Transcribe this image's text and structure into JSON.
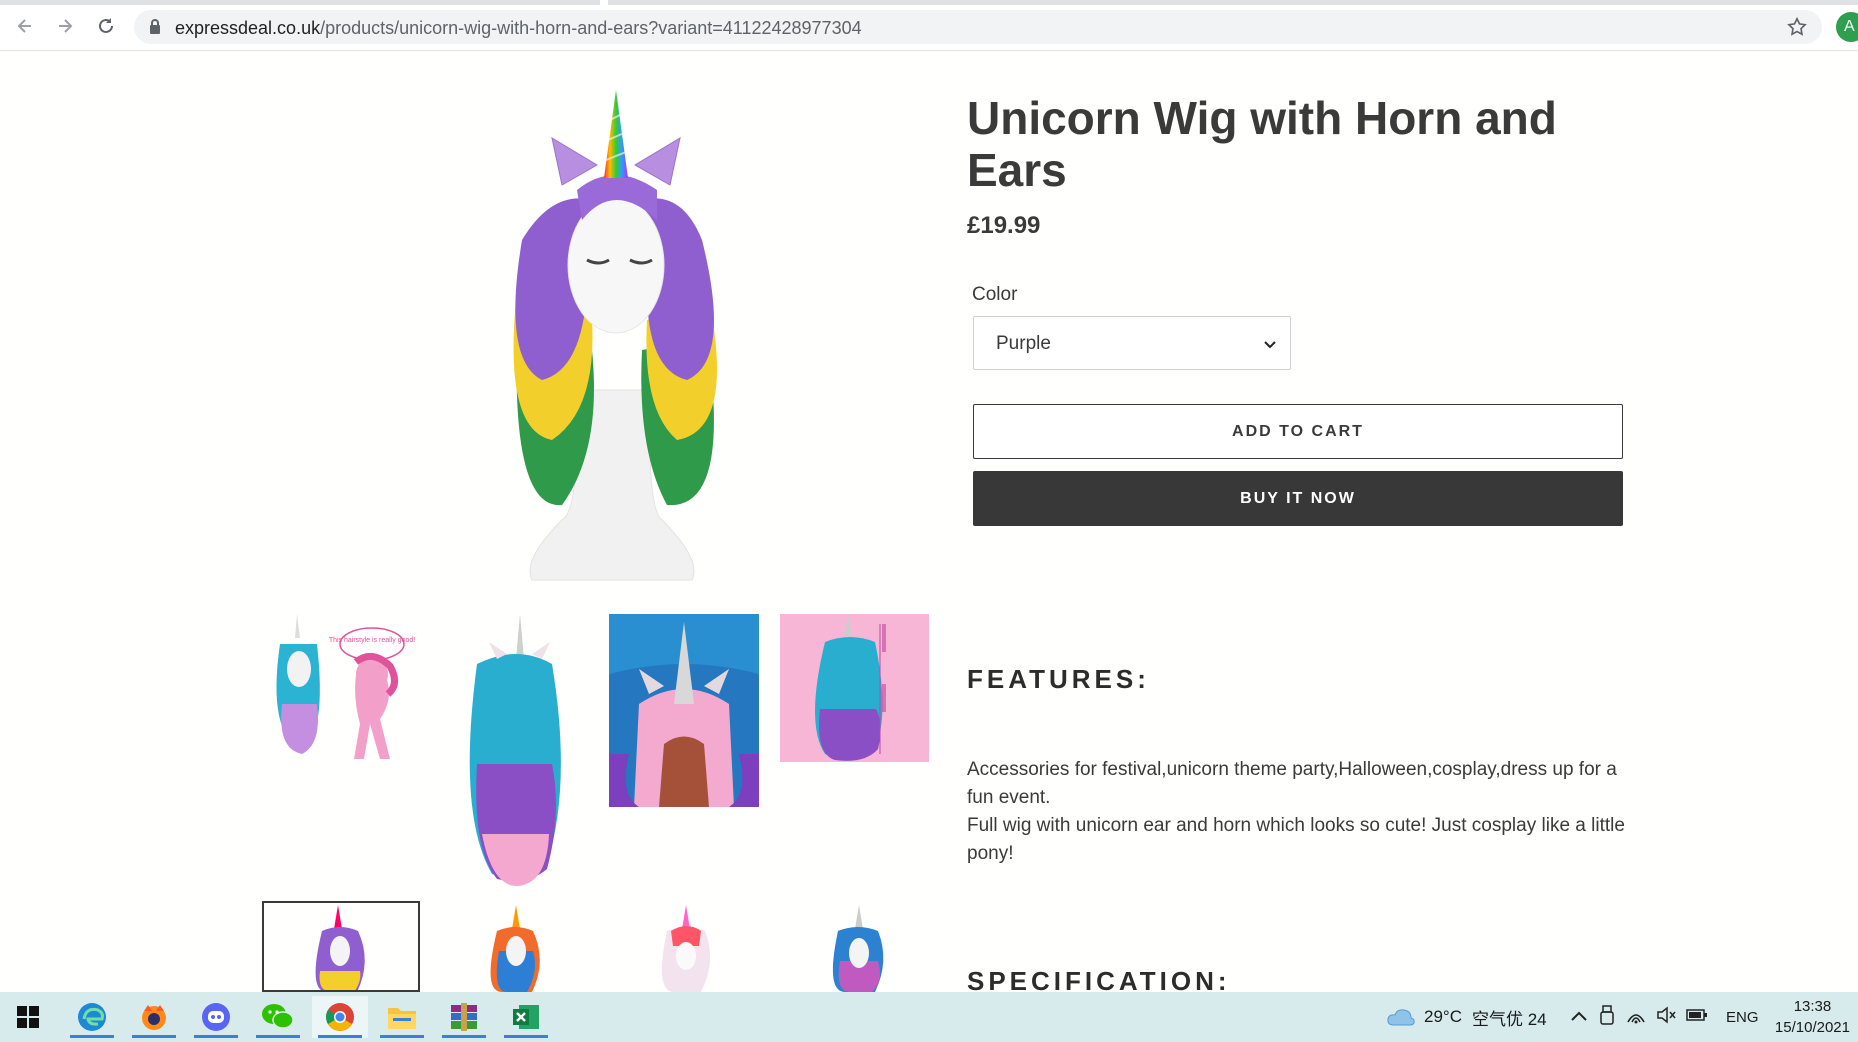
{
  "browser": {
    "url_host": "expressdeal.co.uk",
    "url_path": "/products/unicorn-wig-with-horn-and-ears?variant=41122428977304",
    "profile_initial": "A"
  },
  "product": {
    "title": "Unicorn Wig with Horn and Ears",
    "price": "£19.99",
    "option_label": "Color",
    "option_selected": "Purple",
    "add_to_cart": "ADD TO CART",
    "buy_now": "BUY IT NOW"
  },
  "features": {
    "heading": "FEATURES:",
    "lines": [
      "Accessories for festival,unicorn theme party,Halloween,cosplay,dress up for a fun event.",
      "Full wig with unicorn ear and horn which looks so cute! Just cosplay like a little pony!"
    ]
  },
  "specification": {
    "heading": "SPECIFICATION:"
  },
  "thumb_bubble_text": "This hairstyle is really good!",
  "taskbar": {
    "weather": "29°C",
    "air_quality": "空气优 24",
    "language": "ENG",
    "time": "13:38",
    "date": "15/10/2021",
    "apps": [
      "start-icon",
      "edge-icon",
      "firefox-icon",
      "discord-icon",
      "wechat-icon",
      "chrome-icon",
      "file-explorer-icon",
      "winrar-icon",
      "excel-icon"
    ]
  },
  "colors": {
    "text": "#3a3a3a",
    "buy_button": "#383838",
    "taskbar": "#d7ebed",
    "accent_blue": "#3b7fd6"
  }
}
